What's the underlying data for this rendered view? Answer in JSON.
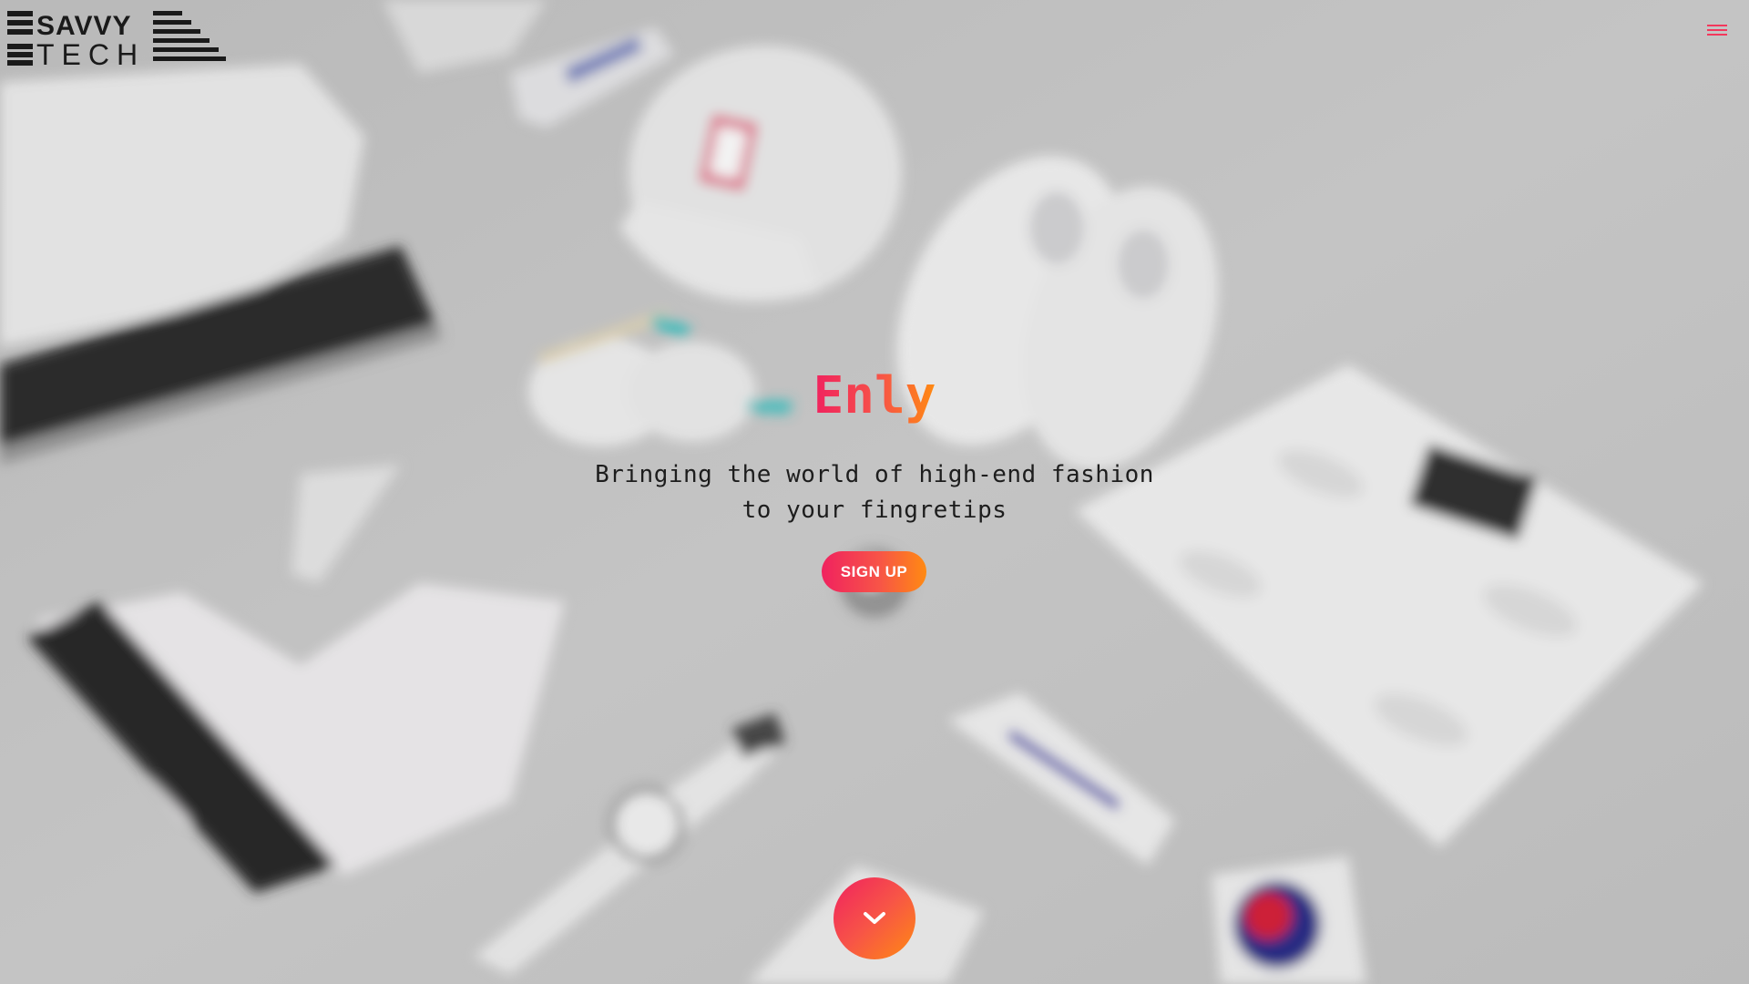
{
  "header": {
    "logo": {
      "line1": "SAVVY",
      "line2": "TECH",
      "icon": "savvy-tech-logo"
    },
    "menu": {
      "icon": "hamburger-menu-icon",
      "color": "#f2385c"
    }
  },
  "hero": {
    "title": "Enly",
    "subtitle_line1": "Bringing the world of high-end fashion",
    "subtitle_line2": "to your fingretips",
    "signup_label": "SIGN UP",
    "scroll_icon": "chevron-down-icon"
  },
  "colors": {
    "gradient_start": "#f0225f",
    "gradient_mid": "#f75447",
    "gradient_end": "#ff8a12",
    "text_dark": "#1d1d1d",
    "background": "#c9c9c9"
  }
}
